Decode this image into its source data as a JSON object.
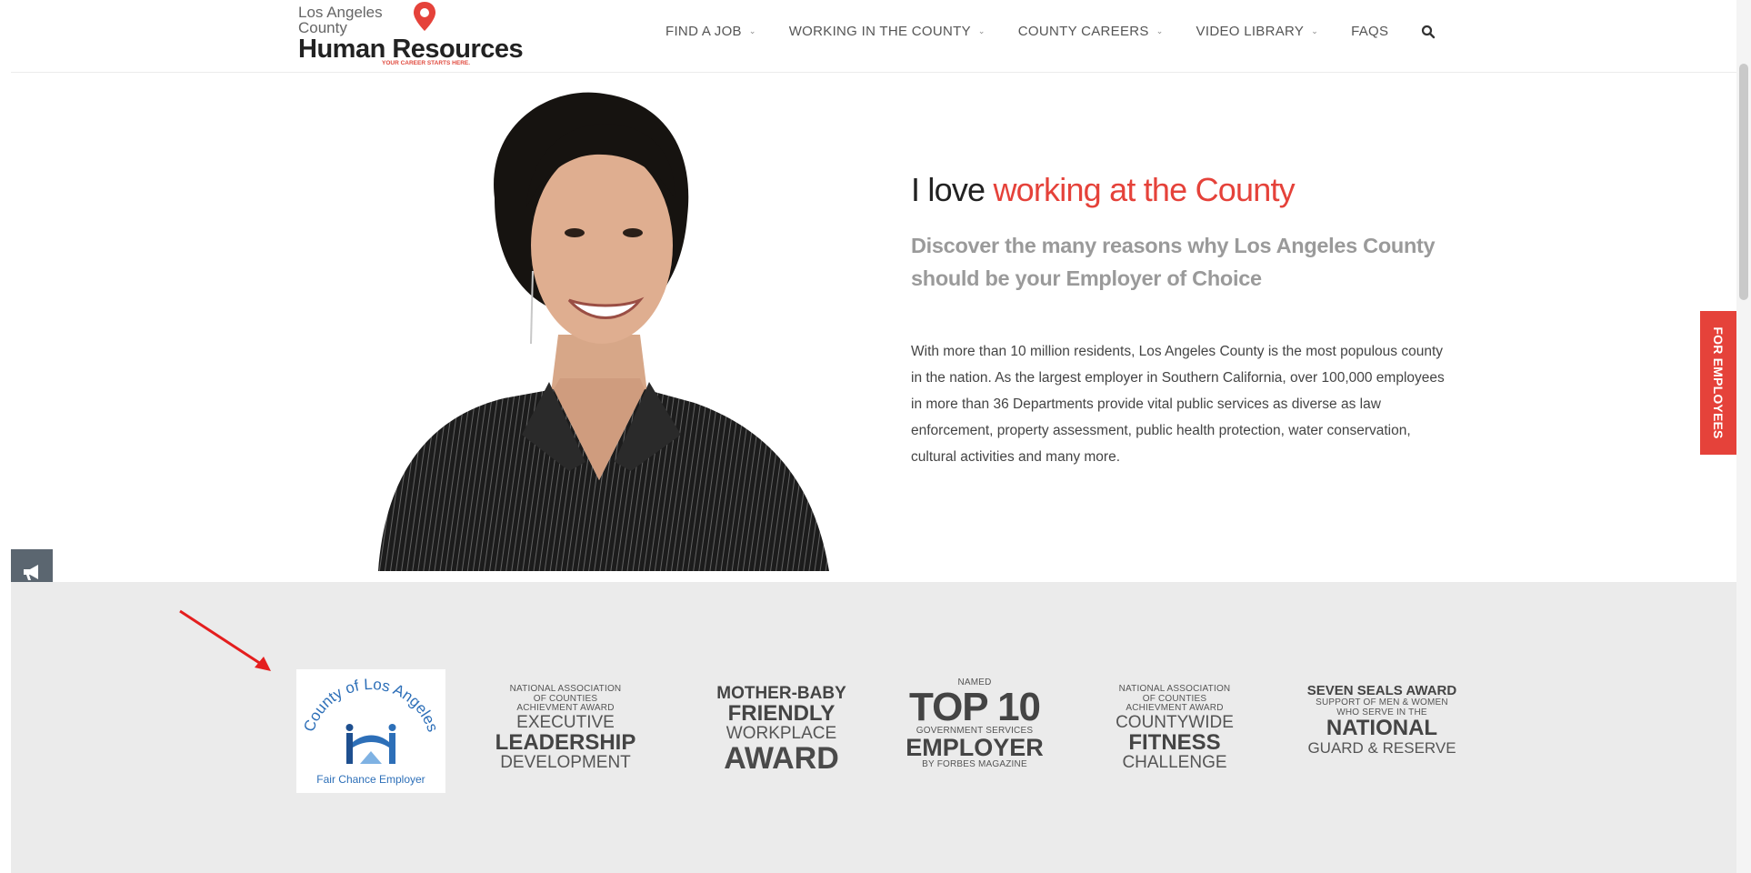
{
  "header": {
    "logo": {
      "line1": "Los Angeles",
      "line2": "County",
      "main": "Human Resources",
      "tagline": "YOUR CAREER STARTS HERE."
    },
    "nav": [
      {
        "label": "FIND A JOB",
        "has_dropdown": true
      },
      {
        "label": "WORKING IN THE COUNTY",
        "has_dropdown": true
      },
      {
        "label": "COUNTY CAREERS",
        "has_dropdown": true
      },
      {
        "label": "VIDEO LIBRARY",
        "has_dropdown": true
      },
      {
        "label": "FAQS",
        "has_dropdown": false
      }
    ],
    "search_icon": "search-icon"
  },
  "hero": {
    "title_plain": "I love",
    "title_accent": "working at the County",
    "subtitle": "Discover the many reasons why Los Angeles County should be your Employer of Choice",
    "body": "With more than 10 million residents, Los Angeles County is the most populous county in the nation. As the largest employer in Southern California, over 100,000 employees in more than 36 Departments provide vital public services as diverse as law enforcement, property assessment, public health protection, water conservation, cultural activities and many more."
  },
  "side_tab": {
    "label": "FOR EMPLOYEES"
  },
  "social": [
    {
      "icon": "megaphone-icon",
      "color": "#5b6670"
    },
    {
      "icon": "paper-plane-icon",
      "color": "#2f86c8"
    },
    {
      "icon": "video-camera-icon",
      "color": "#222222"
    },
    {
      "icon": "calendar-icon",
      "color": "#f5c23a"
    },
    {
      "icon": "envelope-icon",
      "color": "#e5423a"
    }
  ],
  "awards": {
    "fair_chance": {
      "arc_text": "County of Los Angeles",
      "label": "Fair Chance Employer"
    },
    "naco_exec": {
      "l1": "NATIONAL ASSOCIATION",
      "l2": "OF COUNTIES",
      "l3": "ACHIEVMENT AWARD",
      "l4": "EXECUTIVE",
      "l5": "LEADERSHIP",
      "l6": "DEVELOPMENT"
    },
    "mother_baby": {
      "l1": "MOTHER-BABY",
      "l2": "FRIENDLY",
      "l3": "WORKPLACE",
      "l4": "AWARD"
    },
    "top10": {
      "l1": "NAMED",
      "l2": "TOP 10",
      "l3": "GOVERNMENT SERVICES",
      "l4": "EMPLOYER",
      "l5": "BY FORBES MAGAZINE"
    },
    "naco_fitness": {
      "l1": "NATIONAL ASSOCIATION",
      "l2": "OF COUNTIES",
      "l3": "ACHIEVMENT AWARD",
      "l4": "COUNTYWIDE",
      "l5": "FITNESS",
      "l6": "CHALLENGE"
    },
    "seven_seals": {
      "l1": "SEVEN SEALS AWARD",
      "l2": "SUPPORT OF MEN & WOMEN",
      "l3": "WHO SERVE IN THE",
      "l4": "NATIONAL",
      "l5": "GUARD & RESERVE"
    }
  },
  "colors": {
    "accent": "#e5423a",
    "awards_band": "#ebebeb",
    "fair_chance_blue": "#2d6fb8"
  }
}
